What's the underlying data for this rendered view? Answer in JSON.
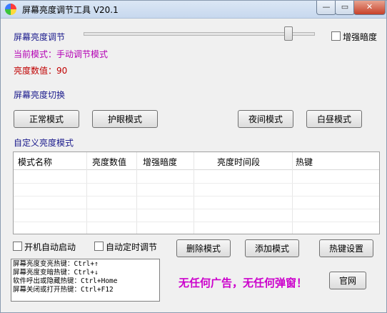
{
  "window": {
    "title": "屏幕亮度调节工具 V20.1",
    "minimize_label": "—",
    "restore_label": "▭",
    "close_label": "✕"
  },
  "brightness": {
    "label": "屏幕亮度调节",
    "slider_level_percent": 90,
    "enhance_label": "增强暗度",
    "enhance_checked": false,
    "current_mode": "当前模式：手动调节模式",
    "value_text": "亮度数值：90"
  },
  "switch_section": {
    "label": "屏幕亮度切换",
    "buttons": [
      "正常模式",
      "护眼模式",
      "夜间模式",
      "白昼模式"
    ]
  },
  "custom_section": {
    "label": "自定义亮度模式",
    "columns": [
      "模式名称",
      "亮度数值",
      "增强暗度",
      "亮度时间段",
      "热键"
    ],
    "rows": []
  },
  "options": {
    "autostart_label": "开机自动启动",
    "autostart_checked": false,
    "auto_schedule_label": "自动定时调节",
    "auto_schedule_checked": false
  },
  "actions": {
    "delete_label": "删除模式",
    "add_label": "添加模式",
    "hotkey_settings_label": "热键设置",
    "website_label": "官网"
  },
  "hotkeys": [
    "屏幕亮度变亮热键：Ctrl+↑",
    "屏幕亮度变暗热键：Ctrl+↓",
    "软件呼出或隐藏热键：Ctrl+Home",
    "屏幕关闭或打开热键：Ctrl+F12"
  ],
  "notice": "无任何广告，无任何弹窗！",
  "colors": {
    "mode_text": "#b400b4",
    "value_text": "#c00000",
    "section_label": "#1a1a8c",
    "notice": "#cc00cc"
  }
}
